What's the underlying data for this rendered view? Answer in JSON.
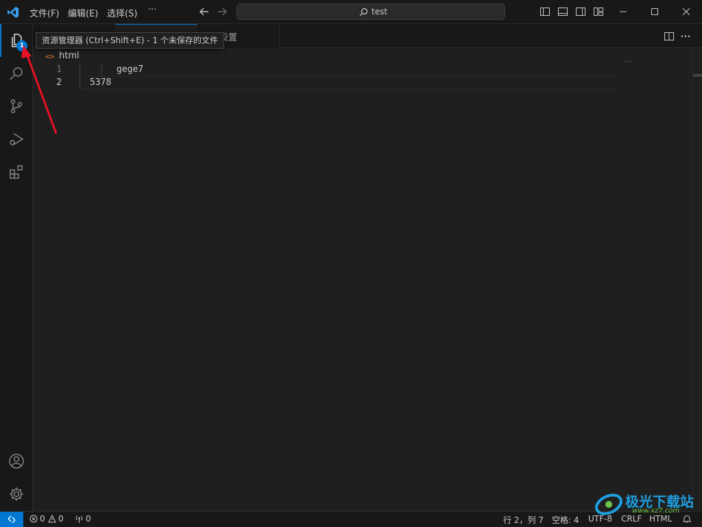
{
  "menu": {
    "file": "文件(F)",
    "edit": "编辑(E)",
    "selection": "选择(S)",
    "more": "···"
  },
  "command_center": {
    "text": "test"
  },
  "tooltip": {
    "text": "资源管理器 (Ctrl+Shift+E) - 1 个未保存的文件"
  },
  "activity": {
    "explorer_badge": "1"
  },
  "tabs": {
    "settings_label": "设置"
  },
  "breadcrumb": {
    "label": "html",
    "icon": "<>"
  },
  "editor": {
    "lines": [
      {
        "num": "1",
        "code": "gege7"
      },
      {
        "num": "2",
        "code": "5378"
      }
    ]
  },
  "minimap": {
    "glyph": "-‒"
  },
  "status": {
    "errors": "0",
    "warnings": "0",
    "ports": "0",
    "position": "行 2，列 7",
    "spaces": "空格: 4",
    "encoding": "UTF-8",
    "eol": "CRLF",
    "language": "HTML"
  },
  "watermark": {
    "text": "极光下载站",
    "url": "www.xz7.com"
  },
  "colors": {
    "accent": "#0078d4",
    "arrow": "#e81123",
    "html_icon": "#e37933"
  }
}
